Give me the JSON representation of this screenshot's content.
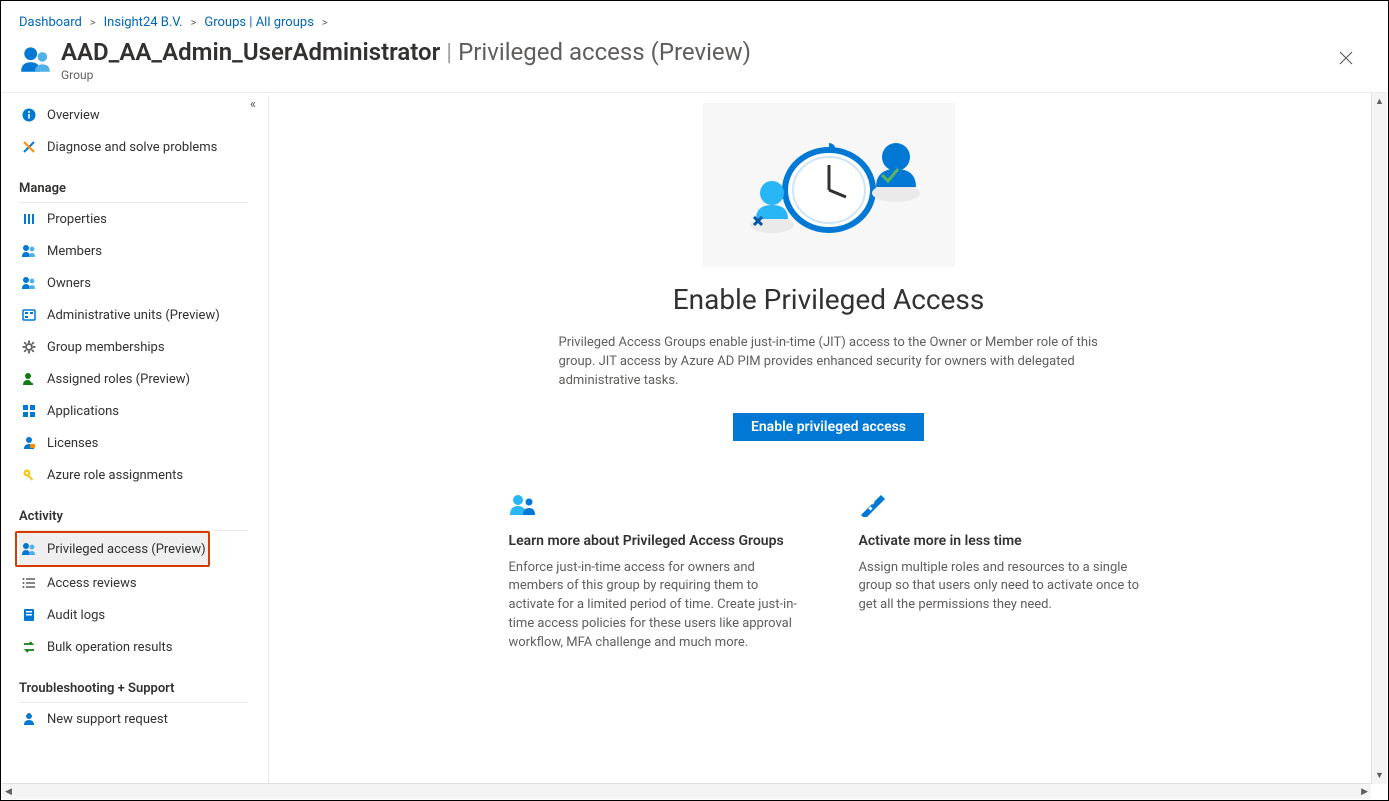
{
  "breadcrumbs": [
    {
      "label": "Dashboard"
    },
    {
      "label": "Insight24 B.V."
    },
    {
      "label": "Groups | All groups"
    }
  ],
  "header": {
    "title_main": "AAD_AA_Admin_UserAdministrator",
    "title_divider": "|",
    "title_suffix": "Privileged access (Preview)",
    "subtitle": "Group"
  },
  "sidebar": {
    "top": [
      {
        "label": "Overview",
        "icon": "info-circle-icon",
        "color": "#0078d4"
      },
      {
        "label": "Diagnose and solve problems",
        "icon": "tools-icon",
        "color": "#0078d4"
      }
    ],
    "sections": [
      {
        "title": "Manage",
        "items": [
          {
            "label": "Properties",
            "icon": "sliders-icon",
            "color": "#0078d4"
          },
          {
            "label": "Members",
            "icon": "people-icon",
            "color": "#0078d4"
          },
          {
            "label": "Owners",
            "icon": "people-icon",
            "color": "#0078d4"
          },
          {
            "label": "Administrative units (Preview)",
            "icon": "directory-icon",
            "color": "#0078d4"
          },
          {
            "label": "Group memberships",
            "icon": "gear-icon",
            "color": "#605e5c"
          },
          {
            "label": "Assigned roles (Preview)",
            "icon": "person-check-icon",
            "color": "#107c10"
          },
          {
            "label": "Applications",
            "icon": "apps-grid-icon",
            "color": "#0078d4"
          },
          {
            "label": "Licenses",
            "icon": "person-license-icon",
            "color": "#0078d4"
          },
          {
            "label": "Azure role assignments",
            "icon": "key-icon",
            "color": "#f2c811"
          }
        ]
      },
      {
        "title": "Activity",
        "items": [
          {
            "label": "Privileged access (Preview)",
            "icon": "people-icon",
            "color": "#0078d4",
            "selected": true,
            "highlight": true
          },
          {
            "label": "Access reviews",
            "icon": "list-check-icon",
            "color": "#605e5c"
          },
          {
            "label": "Audit logs",
            "icon": "book-icon",
            "color": "#0078d4"
          },
          {
            "label": "Bulk operation results",
            "icon": "arrows-swap-icon",
            "color": "#107c10"
          }
        ]
      },
      {
        "title": "Troubleshooting + Support",
        "items": [
          {
            "label": "New support request",
            "icon": "person-support-icon",
            "color": "#0078d4"
          }
        ]
      }
    ]
  },
  "main": {
    "hero_title": "Enable Privileged Access",
    "hero_desc": "Privileged Access Groups enable just-in-time (JIT) access to the Owner or Member role of this group. JIT access by Azure AD PIM provides enhanced security for owners with delegated administrative tasks.",
    "cta_label": "Enable privileged access",
    "cards": [
      {
        "title": "Learn more about Privileged Access Groups",
        "body": "Enforce just-in-time access for owners and members of this group by requiring them to activate for a limited period of time. Create just-in-time access policies for these users like approval workflow, MFA challenge and much more."
      },
      {
        "title": "Activate more in less time",
        "body": "Assign multiple roles and resources to a single group so that users only need to activate once to get all the permissions they need."
      }
    ]
  }
}
